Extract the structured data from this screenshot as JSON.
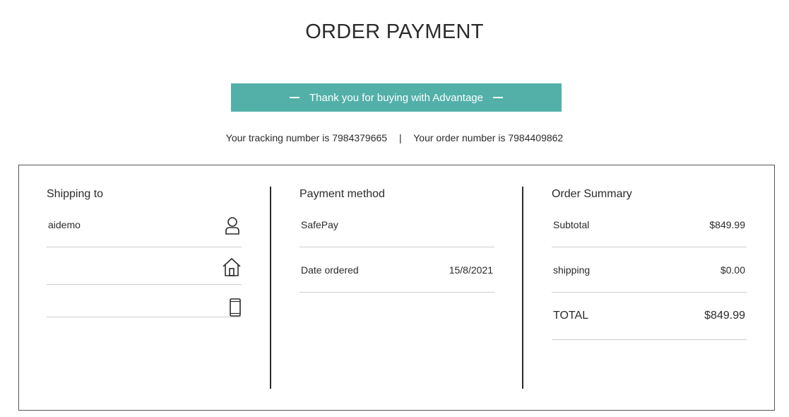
{
  "page": {
    "title": "ORDER PAYMENT"
  },
  "banner": {
    "text": "Thank you for buying with Advantage"
  },
  "tracking": {
    "tracking_text": "Your tracking number is 7984379665",
    "separator": "|",
    "order_text": "Your order number is 7984409862"
  },
  "shipping": {
    "heading": "Shipping to",
    "name": "aidemo",
    "address": "",
    "phone": "",
    "icons": [
      "user-icon",
      "home-icon",
      "phone-icon"
    ]
  },
  "payment": {
    "heading": "Payment method",
    "method": "SafePay",
    "date_label": "Date ordered",
    "date_value": "15/8/2021"
  },
  "summary": {
    "heading": "Order Summary",
    "subtotal_label": "Subtotal",
    "subtotal_value": "$849.99",
    "shipping_label": "shipping",
    "shipping_value": "$0.00",
    "total_label": "TOTAL",
    "total_value": "$849.99"
  },
  "colors": {
    "banner_bg": "#52b0a9",
    "text": "#2b2b2b",
    "divider": "#cfcfcf"
  }
}
